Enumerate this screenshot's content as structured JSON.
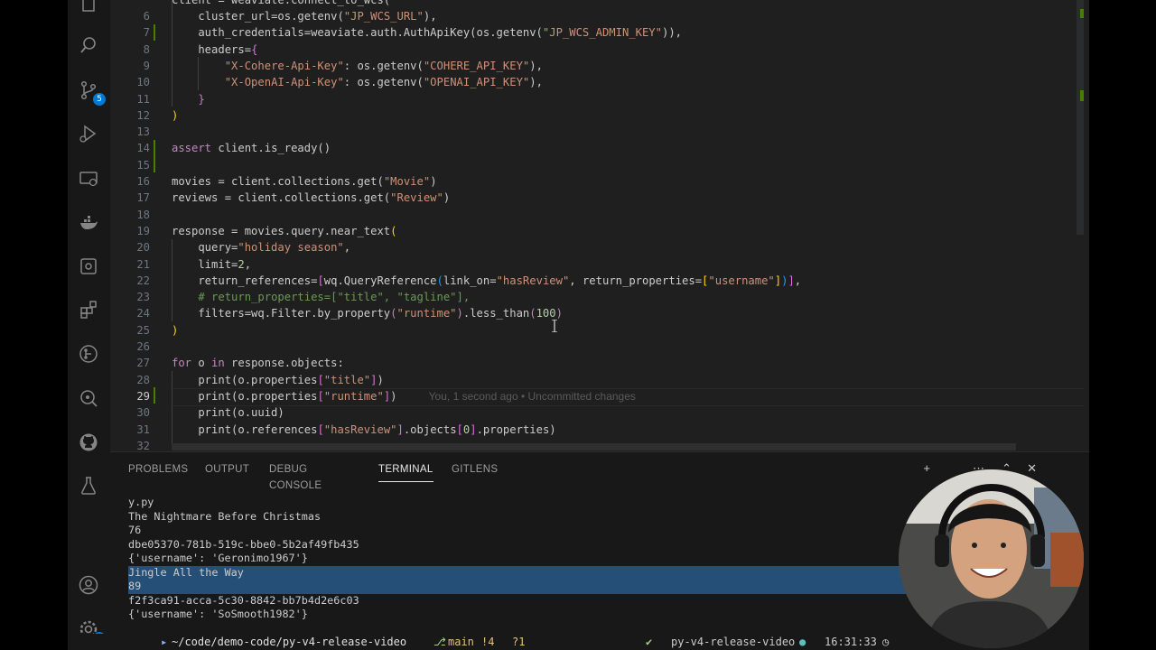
{
  "activity_bar": {
    "scm_badge": "5",
    "settings_badge": "1",
    "icons": [
      "explorer-icon",
      "search-icon",
      "source-control-icon",
      "run-debug-icon",
      "remote-explorer-icon",
      "docker-icon",
      "extensions-icon",
      "gitlens-icon",
      "git-graph-icon",
      "github-icon",
      "testing-icon",
      "account-icon",
      "settings-gear-icon"
    ]
  },
  "editor": {
    "lines": [
      {
        "n": "6",
        "html": "<span class=\"indent-text\">    </span>cluster_url=os.getenv(<span class=\"str\">\"JP_WCS_URL\"</span>),"
      },
      {
        "n": "7",
        "html": "    auth_credentials=weaviate.auth.AuthApiKey(os.getenv(<span class=\"str\">\"JP_WCS_ADMIN_KEY\"</span>)),"
      },
      {
        "n": "8",
        "html": "    headers=<span class=\"br2\">{</span>"
      },
      {
        "n": "9",
        "html": "        <span class=\"str\">\"X-Cohere-Api-Key\"</span>: os.getenv(<span class=\"str\">\"COHERE_API_KEY\"</span>),"
      },
      {
        "n": "10",
        "html": "        <span class=\"str\">\"X-OpenAI-Api-Key\"</span>: os.getenv(<span class=\"str\">\"OPENAI_API_KEY\"</span>),"
      },
      {
        "n": "11",
        "html": "    <span class=\"br2\">}</span>"
      },
      {
        "n": "12",
        "html": "<span class=\"br1\">)</span>"
      },
      {
        "n": "13",
        "html": ""
      },
      {
        "n": "14",
        "html": "<span class=\"kw2\">assert</span> client.is_ready()"
      },
      {
        "n": "15",
        "html": ""
      },
      {
        "n": "16",
        "html": "movies = client.collections.get(<span class=\"str\">\"Movie\"</span>)"
      },
      {
        "n": "17",
        "html": "reviews = client.collections.get(<span class=\"str\">\"Review\"</span>)"
      },
      {
        "n": "18",
        "html": ""
      },
      {
        "n": "19",
        "html": "response = movies.query.near_text<span class=\"br1\">(</span>"
      },
      {
        "n": "20",
        "html": "    query=<span class=\"str\">\"holiday season\"</span>,"
      },
      {
        "n": "21",
        "html": "    limit=<span class=\"num\">2</span>,"
      },
      {
        "n": "22",
        "html": "    return_references=<span class=\"br2\">[</span>wq.QueryReference<span class=\"br3\">(</span>link_on=<span class=\"str\">\"hasReview\"</span>, return_properties=<span class=\"br1\">[</span><span class=\"str\">\"username\"</span><span class=\"br1\">]</span><span class=\"br3\">)</span><span class=\"br2\">]</span>,"
      },
      {
        "n": "23",
        "html": "    <span class=\"cm\"># return_properties=[\"title\", \"tagline\"],</span>"
      },
      {
        "n": "24",
        "html": "    filters=wq.Filter.by_property<span class=\"br2\">(</span><span class=\"str\">\"runtime\"</span><span class=\"br2\">)</span>.less_than<span class=\"br2\">(</span><span class=\"num\">100</span><span class=\"br2\">)</span>"
      },
      {
        "n": "25",
        "html": "<span class=\"br1\">)</span>"
      },
      {
        "n": "26",
        "html": ""
      },
      {
        "n": "27",
        "html": "<span class=\"kw2\">for</span> o <span class=\"kw2\">in</span> response.objects:"
      },
      {
        "n": "28",
        "html": "    print(o.properties<span class=\"br2\">[</span><span class=\"str\">\"title\"</span><span class=\"br2\">]</span>)"
      },
      {
        "n": "29",
        "html": "    print(o.properties<span class=\"br2\">[</span><span class=\"str\">\"runtime\"</span><span class=\"br2\">]</span>)   <span class=\"blame\">    You, 1 second ago • Uncommitted changes</span>"
      },
      {
        "n": "30",
        "html": "    print(o.uuid)"
      },
      {
        "n": "31",
        "html": "    print(o.references<span class=\"br2\">[</span><span class=\"str\">\"hasReview\"</span><span class=\"br2\">]</span>.objects<span class=\"br2\">[</span><span class=\"num\">0</span><span class=\"br2\">]</span>.properties)"
      },
      {
        "n": "32",
        "html": ""
      }
    ],
    "top_partial": "client = weaviate.connect_to_wcs(",
    "active_line": "29"
  },
  "panel": {
    "tabs": [
      "PROBLEMS",
      "OUTPUT",
      "DEBUG CONSOLE",
      "TERMINAL",
      "GITLENS"
    ],
    "active_tab": "TERMINAL",
    "terminal_lines": [
      {
        "text": "y.py",
        "selected": false
      },
      {
        "text": "The Nightmare Before Christmas",
        "selected": false
      },
      {
        "text": "76",
        "selected": false
      },
      {
        "text": "dbe05370-781b-519c-bbe0-5b2af49fb435",
        "selected": false
      },
      {
        "text": "{'username': 'Geronimo1967'}",
        "selected": false
      },
      {
        "text": "Jingle All the Way",
        "selected": true
      },
      {
        "text": "89",
        "selected": true
      },
      {
        "text": "f2f3ca91-acca-5c30-8842-bb7b4d2e6c03",
        "selected": false
      },
      {
        "text": "{'username': 'SoSmooth1982'}",
        "selected": false
      }
    ]
  },
  "statusbar": {
    "path": "~/code/demo-code/py-v4-release-video",
    "branch": "main",
    "changes": "!4",
    "ahead": "?1",
    "env": "py-v4-release-video",
    "time": "16:31:33"
  }
}
